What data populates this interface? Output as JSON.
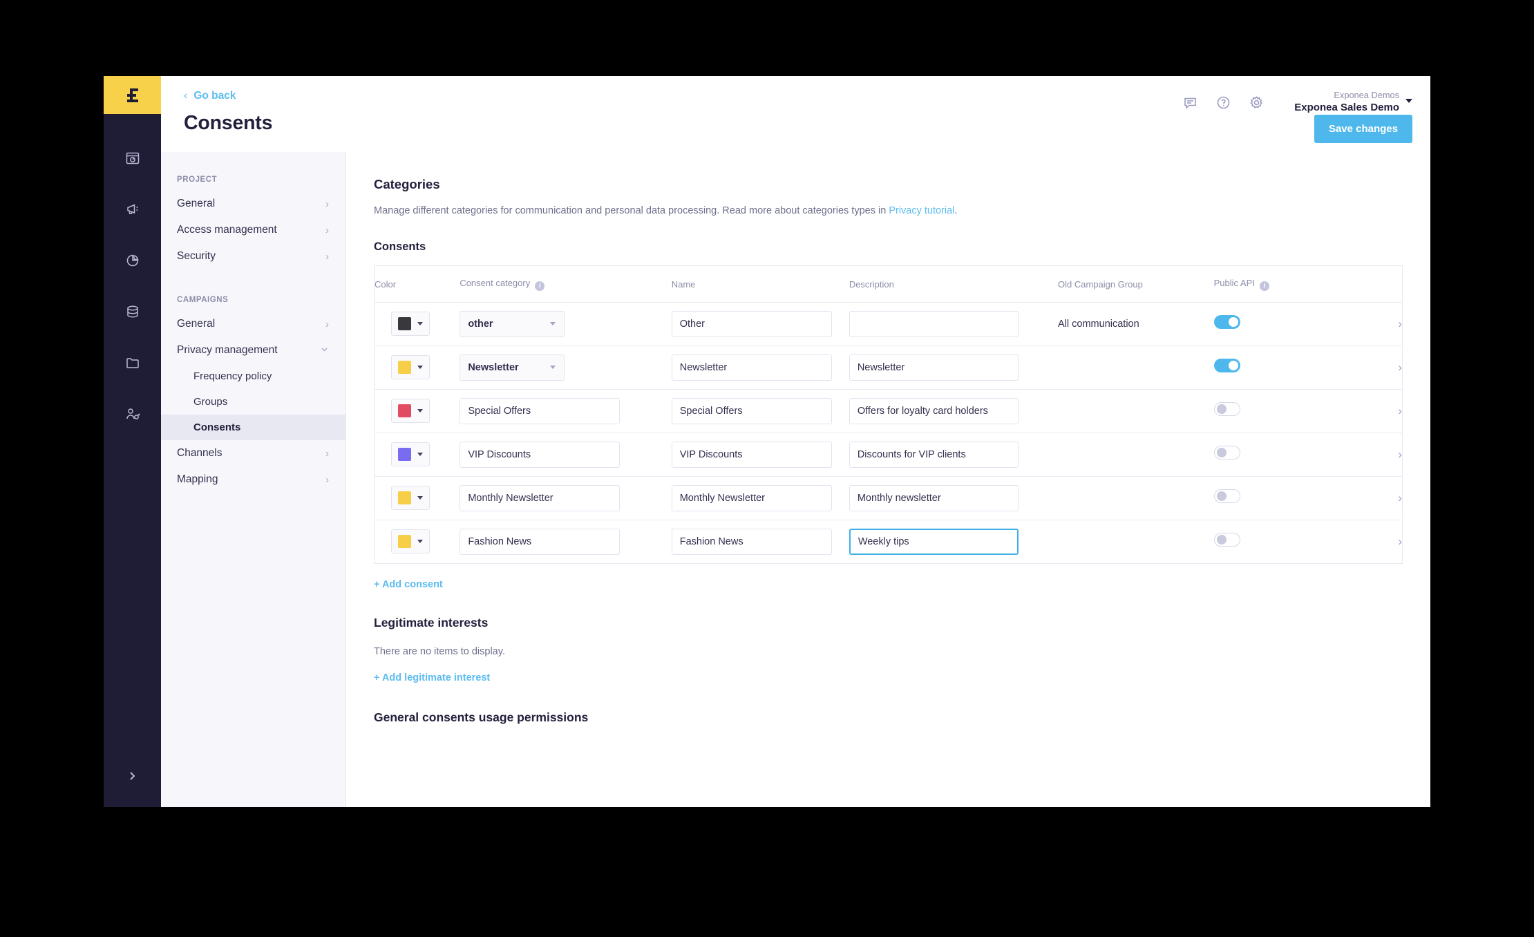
{
  "brand": {
    "logo_name": "exponea-logo",
    "logo_bg": "#f8d14a",
    "accent": "#4eb8ec",
    "rail_bg": "#1f1d36"
  },
  "topbar": {
    "go_back": "Go back",
    "page_title": "Consents",
    "icons": [
      "chat-icon",
      "help-icon",
      "settings-icon"
    ],
    "account": {
      "org": "Exponea Demos",
      "project": "Exponea Sales Demo"
    },
    "save_label": "Save changes"
  },
  "rail": {
    "items": [
      {
        "icon": "dashboard-icon"
      },
      {
        "icon": "campaigns-megaphone-icon"
      },
      {
        "icon": "analytics-pie-icon"
      },
      {
        "icon": "data-database-icon"
      },
      {
        "icon": "assets-folder-icon"
      },
      {
        "icon": "user-access-icon"
      }
    ],
    "expand_icon": "chevron-right-icon"
  },
  "sidebar": {
    "groups": [
      {
        "label": "PROJECT",
        "items": [
          {
            "label": "General",
            "chevron": "›",
            "active": false,
            "sub": false
          },
          {
            "label": "Access management",
            "chevron": "›",
            "active": false,
            "sub": false
          },
          {
            "label": "Security",
            "chevron": "›",
            "active": false,
            "sub": false
          }
        ]
      },
      {
        "label": "CAMPAIGNS",
        "items": [
          {
            "label": "General",
            "chevron": "›",
            "active": false,
            "sub": false
          },
          {
            "label": "Privacy management",
            "chevron": "∨",
            "active": false,
            "sub": false
          },
          {
            "label": "Frequency policy",
            "chevron": "",
            "active": false,
            "sub": true
          },
          {
            "label": "Groups",
            "chevron": "",
            "active": false,
            "sub": true
          },
          {
            "label": "Consents",
            "chevron": "",
            "active": true,
            "sub": true
          },
          {
            "label": "Channels",
            "chevron": "›",
            "active": false,
            "sub": false
          },
          {
            "label": "Mapping",
            "chevron": "›",
            "active": false,
            "sub": false
          }
        ]
      }
    ]
  },
  "content": {
    "categories_heading": "Categories",
    "categories_desc_before": "Manage different categories for communication and personal data processing. Read more about categories types in ",
    "categories_desc_link": "Privacy tutorial",
    "categories_desc_after": ".",
    "consents_heading": "Consents",
    "columns": {
      "color": "Color",
      "consent_category": "Consent category",
      "name": "Name",
      "description": "Description",
      "old_campaign_group": "Old Campaign Group",
      "public_api": "Public API"
    },
    "rows": [
      {
        "color": "#38383d",
        "category_value": "other",
        "category_is_select": true,
        "name": "Other",
        "description": "",
        "old_campaign_group": "All communication",
        "public_api": true,
        "description_focused": false
      },
      {
        "color": "#f6ce47",
        "category_value": "Newsletter",
        "category_is_select": true,
        "name": "Newsletter",
        "description": "Newsletter",
        "old_campaign_group": "",
        "public_api": true,
        "description_focused": false
      },
      {
        "color": "#e04d63",
        "category_value": "Special Offers",
        "category_is_select": false,
        "name": "Special Offers",
        "description": "Offers for loyalty card holders",
        "old_campaign_group": "",
        "public_api": false,
        "description_focused": false
      },
      {
        "color": "#7a6cf0",
        "category_value": "VIP Discounts",
        "category_is_select": false,
        "name": "VIP Discounts",
        "description": "Discounts for VIP clients",
        "old_campaign_group": "",
        "public_api": false,
        "description_focused": false
      },
      {
        "color": "#f6ce47",
        "category_value": "Monthly Newsletter",
        "category_is_select": false,
        "name": "Monthly Newsletter",
        "description": "Monthly newsletter",
        "old_campaign_group": "",
        "public_api": false,
        "description_focused": false
      },
      {
        "color": "#f6ce47",
        "category_value": "Fashion News",
        "category_is_select": false,
        "name": "Fashion News",
        "description": "Weekly tips",
        "old_campaign_group": "",
        "public_api": false,
        "description_focused": true
      }
    ],
    "add_consent": "+ Add consent",
    "legitimate_heading": "Legitimate interests",
    "legitimate_empty": "There are no items to display.",
    "add_legitimate": "+ Add legitimate interest",
    "general_heading": "General consents usage permissions"
  }
}
